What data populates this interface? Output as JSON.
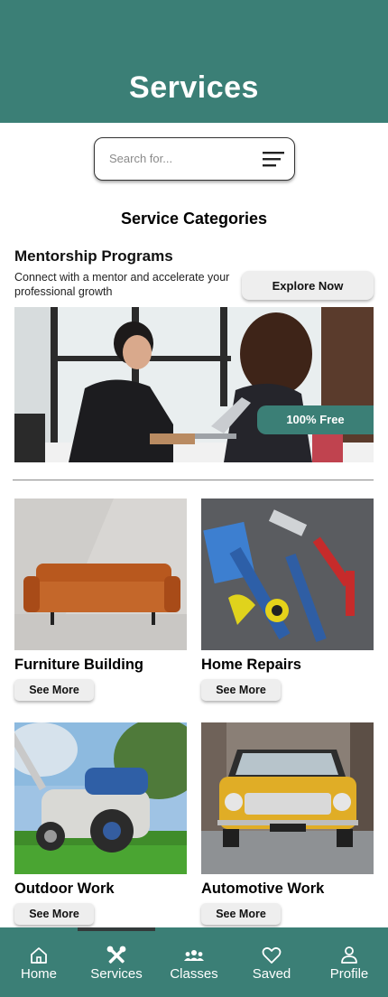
{
  "header": {
    "title": "Services"
  },
  "search": {
    "placeholder": "Search for..."
  },
  "section": {
    "title": "Service Categories"
  },
  "mentorship": {
    "title": "Mentorship Programs",
    "description": "Connect with a mentor and accelerate your professional growth",
    "button_label": "Explore Now",
    "badge": "100% Free"
  },
  "categories": [
    {
      "title": "Furniture Building",
      "button_label": "See More"
    },
    {
      "title": "Home Repairs",
      "button_label": "See More"
    },
    {
      "title": "Outdoor Work",
      "button_label": "See More"
    },
    {
      "title": "Automotive Work",
      "button_label": "See More"
    }
  ],
  "nav": {
    "active": "Services",
    "items": [
      {
        "label": "Home",
        "icon": "home-icon"
      },
      {
        "label": "Services",
        "icon": "tools-icon"
      },
      {
        "label": "Classes",
        "icon": "group-icon"
      },
      {
        "label": "Saved",
        "icon": "heart-icon"
      },
      {
        "label": "Profile",
        "icon": "person-icon"
      }
    ]
  },
  "colors": {
    "accent": "#3b7f76",
    "button_bg": "#eeeeee"
  }
}
